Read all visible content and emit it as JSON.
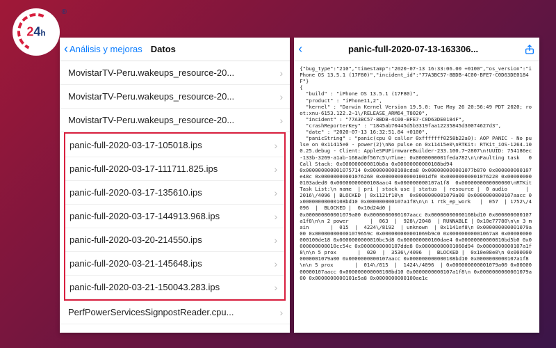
{
  "logo": {
    "num": "24",
    "suffix": "h"
  },
  "left_panel": {
    "back_label": "Análisis y mejoras",
    "title": "Datos",
    "rows_top": [
      "MovistarTV-Peru.wakeups_resource-20...",
      "MovistarTV-Peru.wakeups_resource-20...",
      "MovistarTV-Peru.wakeups_resource-20..."
    ],
    "rows_highlight": [
      "panic-full-2020-03-17-105018.ips",
      "panic-full-2020-03-17-111711.825.ips",
      "panic-full-2020-03-17-135610.ips",
      "panic-full-2020-03-17-144913.968.ips",
      "panic-full-2020-03-20-214550.ips",
      "panic-full-2020-03-21-145648.ips",
      "panic-full-2020-03-21-150043.283.ips"
    ],
    "rows_bottom": [
      "PerfPowerServicesSignpostReader.cpu..."
    ]
  },
  "right_panel": {
    "title": "panic-full-2020-07-13-163306...",
    "log_text": "{\"bug_type\":\"210\",\"timestamp\":\"2020-07-13 16:33:06.00 +0100\",\"os_version\":\"iPhone OS 13.5.1 (17F80)\",\"incident_id\":\"77A3BC57-8BDB-4C00-BFE7-C0D63DE0184F\"}\n{\n  \"build\" : \"iPhone OS 13.5.1 (17F80)\",\n  \"product\" : \"iPhone11,2\",\n  \"kernel\" : \"Darwin Kernel Version 19.5.0: Tue May 26 20:56:49 PDT 2020; root:xnu-6153.122.2~1\\/RELEASE_ARM64_T8020\",\n  \"incident\" : \"77A3BC57-8BDB-4C00-BFE7-C0D63DE0184F\",\n  \"crashReporterKey\" : \"1845ab70445d5b3319faa12235845d30074627d3\",\n  \"date\" : \"2020-07-13 16:32:51.84 +0100\",\n  \"panicString\" : \"panic(cpu 0 caller 0xfffffff0258b22a0): AOP PANIC - No pulse on 0x11415e0 - power(2)\\nNo pulse on 0x11415e0\\nRTKit: RTKit_iOS-1264.100.25.debug - Client: AppleSPUFirmwareBuilder-233.100.7~2807\\n!UUID: 754186ec-133b-3269-a1ab-168ad0f567c5\\nTime: 0x0000000001feda782\\n\\nFaulting task   0 Call Stack: 0x000000000010b8a 0x00000000000108bd94\n0x000000000001075714 0x000000000108cda8 0x000000000001077b870 0x000000000107e48c 0x00000000001076260 0x000000000001001df0 0x00000000001076220 0x000000000103aded0 0x00000000000108aac4 0x000000000107a1f8  0x0000000000000000\\nRTKit Task List:\\n name  | pri | stack use | status  | resource |  0 audio      | 2016\\/4096 | BLOCKED | 0x1121f10\\n  0x0000000001079a00 0x0000000000107aacc 0x00000000000108bd10 0x000000000107a1f8\\n\\n 1 rtk_ep_work   |  057  | 1752\\/4096  |  BLOCKED |  0x10d24d0 |\n0x000000000001079a00 0x0000000000107aacc 0x00000000000108bd10 0x000000000107a1f8\\n\\n 2 power       |  063  |  928\\/2048  | RUNNABLE | 0x10e77780\\n\\n 3 main       |  015  |  4224\\/8192  | unknown  | 0x1141ef8\\n 0x000000000001079a00 0x000000000001079659c 0x000000000001069b9c0 0x00000000001067a8 0x00000000000100de18 0x0000000000010bc5d8 0x000000000100dae4 0x00000000000010bd5b0 0x0000000000010cc54c 0x0000000000107dde8 0x00000000001060d94 0x0000000000107a1f8\\n\\n 5 prox       |  020  |  3536\\/4096  |  BLOCKED |  0x10e08e0\\n 0x0000000000001079a00 0x0000000000107aacc 0x000000000000108bd10 0x0000000000107a1f8\\n\\n 5 prox       |  014\\/015  |  1424\\/4096  | 0x000000000001079a00 0x0000000000107aacc 0x000000000000108bd10 0x0000000000107a1f8\\n 0x0000000000001079a00 0x0000000000101e5a8 0x0000000000100ae1c"
  }
}
